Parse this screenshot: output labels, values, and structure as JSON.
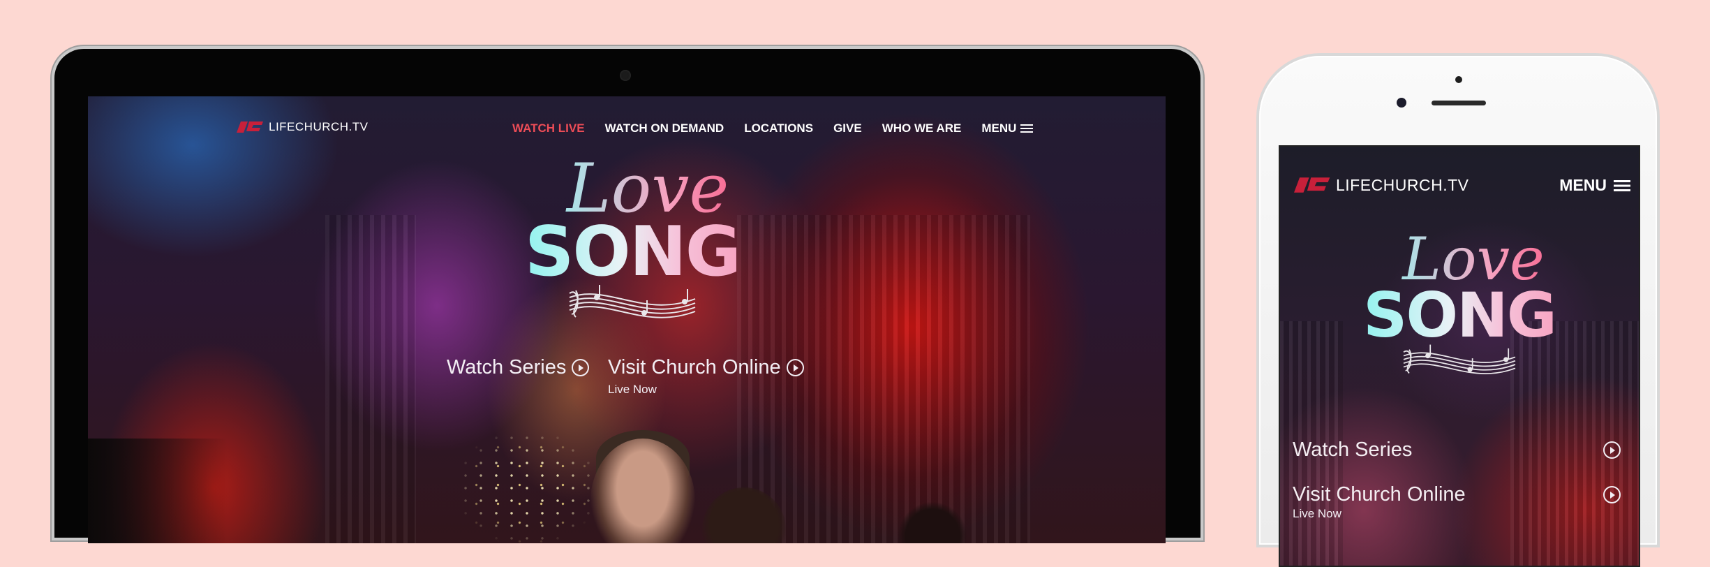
{
  "brand": {
    "logo_text": "LIFECHURCH.TV",
    "accent": "#ee4d57",
    "logo_red": "#c8203a"
  },
  "desktop": {
    "nav": [
      {
        "label": "WATCH LIVE",
        "active": true
      },
      {
        "label": "WATCH ON DEMAND",
        "active": false
      },
      {
        "label": "LOCATIONS",
        "active": false
      },
      {
        "label": "GIVE",
        "active": false
      },
      {
        "label": "WHO WE ARE",
        "active": false
      }
    ],
    "menu_label": "MENU",
    "hero": {
      "title_script": "Love",
      "title_block": "SONG"
    },
    "cta": {
      "watch_series": "Watch Series",
      "visit_online": "Visit Church Online",
      "visit_sub": "Live Now"
    }
  },
  "mobile": {
    "menu_label": "MENU",
    "hero": {
      "title_script": "Love",
      "title_block": "SONG"
    },
    "watch_series": "Watch Series",
    "visit_online": "Visit Church Online",
    "visit_sub": "Live Now"
  },
  "icons": [
    "lifechurch-logo-icon",
    "hamburger-icon",
    "play-circle-icon",
    "music-staff-icon"
  ],
  "colors": {
    "page_background": "#fdd8d2",
    "nav_text": "#ffffff",
    "active_nav": "#ee4d57"
  }
}
